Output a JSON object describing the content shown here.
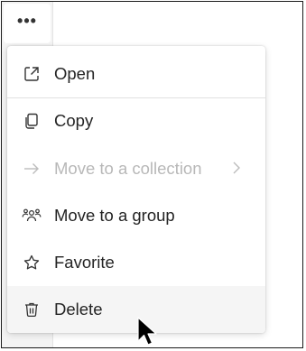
{
  "more_button": {
    "label": "•••",
    "icon": "more-horizontal-icon"
  },
  "menu": {
    "items": [
      {
        "label": "Open",
        "icon": "open-external-icon",
        "disabled": false
      },
      {
        "label": "Copy",
        "icon": "copy-icon",
        "disabled": false
      },
      {
        "label": "Move to a collection",
        "icon": "arrow-right-icon",
        "disabled": true,
        "submenu_icon": "chevron-right-icon"
      },
      {
        "label": "Move to a group",
        "icon": "people-group-icon",
        "disabled": false
      },
      {
        "label": "Favorite",
        "icon": "star-icon",
        "disabled": false
      },
      {
        "label": "Delete",
        "icon": "trash-icon",
        "disabled": false,
        "hovered": true
      }
    ]
  },
  "colors": {
    "text": "#242424",
    "disabled_text": "#b8b8b8",
    "hover_bg": "#f5f5f5"
  }
}
